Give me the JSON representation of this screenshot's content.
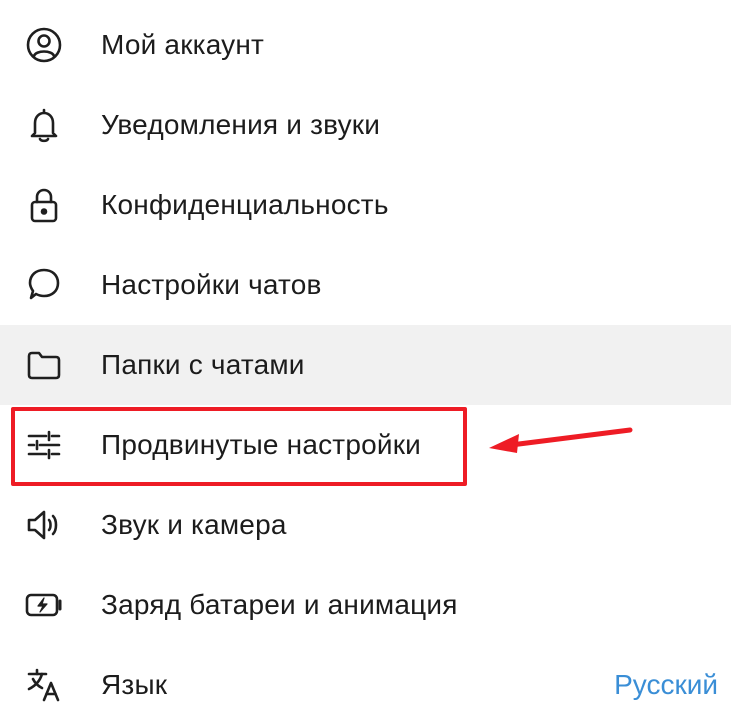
{
  "menu": {
    "items": [
      {
        "label": "Мой аккаунт",
        "icon": "account-icon"
      },
      {
        "label": "Уведомления и звуки",
        "icon": "bell-icon"
      },
      {
        "label": "Конфиденциальность",
        "icon": "lock-icon"
      },
      {
        "label": "Настройки чатов",
        "icon": "chat-bubble-icon"
      },
      {
        "label": "Папки с чатами",
        "icon": "folder-icon"
      },
      {
        "label": "Продвинутые настройки",
        "icon": "sliders-icon"
      },
      {
        "label": "Звук и камера",
        "icon": "speaker-icon"
      },
      {
        "label": "Заряд батареи и анимация",
        "icon": "battery-icon"
      },
      {
        "label": "Язык",
        "icon": "translate-icon",
        "value": "Русский"
      }
    ]
  },
  "colors": {
    "highlight": "#ee1c25",
    "link": "#3a8ed6",
    "hover_background": "#f1f1f1"
  }
}
